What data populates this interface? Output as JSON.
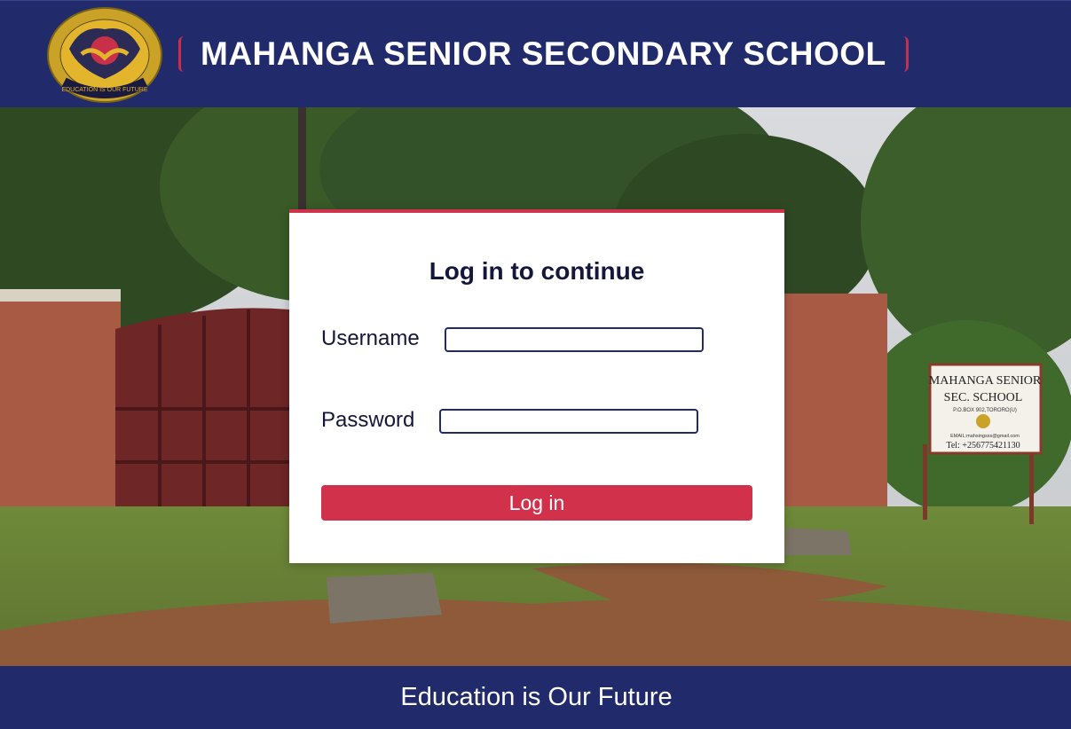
{
  "header": {
    "school_name": "MAHANGA SENIOR SECONDARY SCHOOL",
    "logo_icon": "school-crest-icon",
    "logo_motto": "EDUCATION IS OUR FUTURE"
  },
  "login": {
    "title": "Log in to continue",
    "username_label": "Username",
    "username_value": "",
    "password_label": "Password",
    "password_value": "",
    "submit_label": "Log in"
  },
  "background": {
    "sign_line1": "MAHANGA SENIOR",
    "sign_line2": "SEC. SCHOOL",
    "sign_address": "P.O.BOX 902,TORORO(U)",
    "sign_email": "EMAIL:mahsingsss@gmail.com",
    "sign_tel": "Tel: +256775421130"
  },
  "footer": {
    "tagline": "Education is Our Future"
  },
  "colors": {
    "navy": "#212a6a",
    "accent_red": "#d2314c",
    "card_bg": "#ffffff"
  }
}
